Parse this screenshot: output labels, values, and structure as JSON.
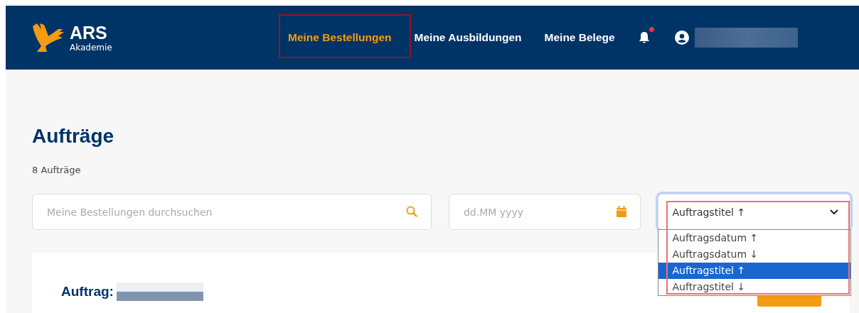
{
  "logo": {
    "name": "ARS",
    "subtitle": "Akademie"
  },
  "nav": [
    {
      "label": "Meine Bestellungen",
      "selected": true
    },
    {
      "label": "Meine Ausbildungen",
      "selected": false
    },
    {
      "label": "Meine Belege",
      "selected": false
    }
  ],
  "notifications": {
    "unread": true
  },
  "page": {
    "title": "Aufträge",
    "count": "8 Aufträge"
  },
  "search": {
    "placeholder": "Meine Bestellungen durchsuchen"
  },
  "date": {
    "placeholder": "dd.MM yyyy"
  },
  "sort": {
    "value": "Auftragstitel ↑",
    "expanded": true,
    "options": [
      {
        "label": "Auftragsdatum ↑",
        "selected": false
      },
      {
        "label": "Auftragsdatum ↓",
        "selected": false
      },
      {
        "label": "Auftragstitel ↑",
        "selected": true
      },
      {
        "label": "Auftragstitel ↓",
        "selected": false
      }
    ]
  },
  "order": {
    "label": "Auftrag:"
  }
}
